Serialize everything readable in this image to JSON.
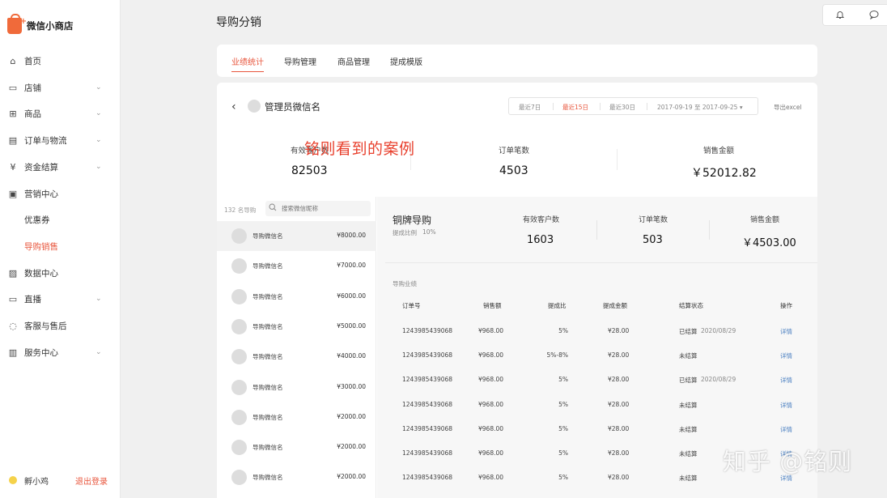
{
  "brand": {
    "name": "微信小商店"
  },
  "sidebar": {
    "items": [
      {
        "label": "首页",
        "icon": "home-icon",
        "glyph": "⌂",
        "chevron": false,
        "active": false
      },
      {
        "label": "店铺",
        "icon": "store-icon",
        "glyph": "▭",
        "chevron": true,
        "active": false
      },
      {
        "label": "商品",
        "icon": "grid-icon",
        "glyph": "⊞",
        "chevron": true,
        "active": false
      },
      {
        "label": "订单与物流",
        "icon": "order-icon",
        "glyph": "▤",
        "chevron": true,
        "active": false
      },
      {
        "label": "资金结算",
        "icon": "yuan-icon",
        "glyph": "¥",
        "chevron": true,
        "active": false
      },
      {
        "label": "营销中心",
        "icon": "gift-icon",
        "glyph": "▣",
        "chevron": false,
        "active": false
      },
      {
        "label": "优惠券",
        "icon": "",
        "glyph": "",
        "chevron": false,
        "active": false
      },
      {
        "label": "导购销售",
        "icon": "",
        "glyph": "",
        "chevron": false,
        "active": true
      },
      {
        "label": "数据中心",
        "icon": "chart-icon",
        "glyph": "▨",
        "chevron": false,
        "active": false
      },
      {
        "label": "直播",
        "icon": "video-icon",
        "glyph": "▭",
        "chevron": true,
        "active": false
      },
      {
        "label": "客服与售后",
        "icon": "headset-icon",
        "glyph": "◌",
        "chevron": false,
        "active": false
      },
      {
        "label": "服务中心",
        "icon": "briefcase-icon",
        "glyph": "▥",
        "chevron": true,
        "active": false
      }
    ],
    "user": {
      "name": "孵小鸡",
      "logout": "退出登录"
    }
  },
  "header": {
    "title": "导购分销"
  },
  "tabs": [
    {
      "label": "业绩统计",
      "active": true
    },
    {
      "label": "导购管理",
      "active": false
    },
    {
      "label": "商品管理",
      "active": false
    },
    {
      "label": "提成模版",
      "active": false
    }
  ],
  "admin": {
    "name": "管理员微信名"
  },
  "date_filter": {
    "options": [
      {
        "label": "最近7日",
        "active": false
      },
      {
        "label": "最近15日",
        "active": true
      },
      {
        "label": "最近30日",
        "active": false
      }
    ],
    "range": "2017-09-19 至 2017-09-25 ▾"
  },
  "export_label": "导出excel",
  "summary": [
    {
      "label": "有效客户数",
      "value": "82503"
    },
    {
      "label": "订单笔数",
      "value": "4503"
    },
    {
      "label": "销售金额",
      "value": "￥52012.82"
    }
  ],
  "overlay_text": "铭则看到的案例",
  "guide_list": {
    "count": "132 名导购",
    "search_placeholder": "搜索微信昵称",
    "rows": [
      {
        "name": "导购微信名",
        "amount": "¥8000.00"
      },
      {
        "name": "导购微信名",
        "amount": "¥7000.00"
      },
      {
        "name": "导购微信名",
        "amount": "¥6000.00"
      },
      {
        "name": "导购微信名",
        "amount": "¥5000.00"
      },
      {
        "name": "导购微信名",
        "amount": "¥4000.00"
      },
      {
        "name": "导购微信名",
        "amount": "¥3000.00"
      },
      {
        "name": "导购微信名",
        "amount": "¥2000.00"
      },
      {
        "name": "导购微信名",
        "amount": "¥2000.00"
      },
      {
        "name": "导购微信名",
        "amount": "¥2000.00"
      }
    ]
  },
  "detail": {
    "name": "铜牌导购",
    "rate_label": "提成比例",
    "rate": "10%",
    "stats": [
      {
        "label": "有效客户数",
        "value": "1603"
      },
      {
        "label": "订单笔数",
        "value": "503"
      },
      {
        "label": "销售金额",
        "value": "￥4503.00"
      }
    ],
    "perf_title": "导购业绩",
    "columns": [
      "订单号",
      "销售额",
      "提成比",
      "提成金额",
      "结算状态",
      "操作"
    ],
    "rows": [
      {
        "order": "1243985439068",
        "sales": "¥968.00",
        "ratio": "5%",
        "commission": "¥28.00",
        "status": "已结算",
        "date": "2020/08/29",
        "action": "详情"
      },
      {
        "order": "1243985439068",
        "sales": "¥968.00",
        "ratio": "5%-8%",
        "commission": "¥28.00",
        "status": "未结算",
        "date": "",
        "action": "详情"
      },
      {
        "order": "1243985439068",
        "sales": "¥968.00",
        "ratio": "5%",
        "commission": "¥28.00",
        "status": "已结算",
        "date": "2020/08/29",
        "action": "详情"
      },
      {
        "order": "1243985439068",
        "sales": "¥968.00",
        "ratio": "5%",
        "commission": "¥28.00",
        "status": "未结算",
        "date": "",
        "action": "详情"
      },
      {
        "order": "1243985439068",
        "sales": "¥968.00",
        "ratio": "5%",
        "commission": "¥28.00",
        "status": "未结算",
        "date": "",
        "action": "详情"
      },
      {
        "order": "1243985439068",
        "sales": "¥968.00",
        "ratio": "5%",
        "commission": "¥28.00",
        "status": "未结算",
        "date": "",
        "action": "详情"
      },
      {
        "order": "1243985439068",
        "sales": "¥968.00",
        "ratio": "5%",
        "commission": "¥28.00",
        "status": "未结算",
        "date": "",
        "action": "详情"
      }
    ]
  },
  "watermark": "知乎 @铭则",
  "colors": {
    "accent": "#e8563d",
    "link": "#4a7fc1"
  }
}
